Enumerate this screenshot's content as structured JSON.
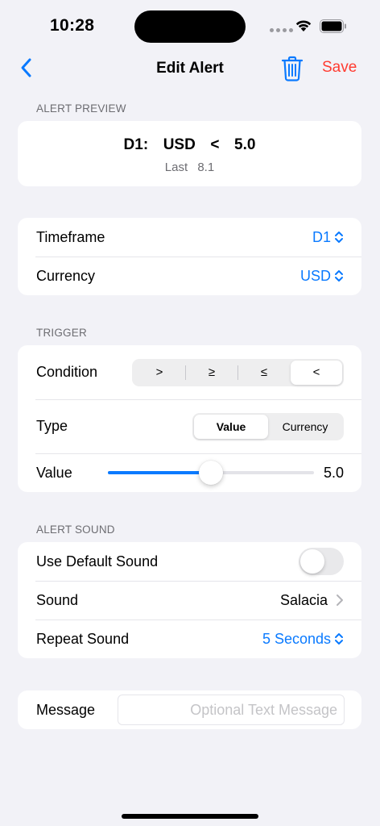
{
  "status_bar": {
    "time": "10:28"
  },
  "nav": {
    "title": "Edit Alert",
    "save_label": "Save",
    "back_icon": "chevron-left-icon",
    "delete_icon": "trash-icon"
  },
  "colors": {
    "accent": "#0A7AFF",
    "destructive": "#FF3B30",
    "background": "#F2F2F7"
  },
  "preview": {
    "header": "ALERT PREVIEW",
    "expression": "D1:  USD  <  5.0",
    "last_label": "Last",
    "last_value": "8.1"
  },
  "general": {
    "timeframe_label": "Timeframe",
    "timeframe_value": "D1",
    "currency_label": "Currency",
    "currency_value": "USD"
  },
  "trigger": {
    "header": "TRIGGER",
    "condition_label": "Condition",
    "conditions": [
      ">",
      "≥",
      "≤",
      "<"
    ],
    "condition_selected": "<",
    "type_label": "Type",
    "types": [
      "Value",
      "Currency"
    ],
    "type_selected": "Value",
    "value_label": "Value",
    "value_display": "5.0",
    "slider_fraction": 0.5
  },
  "sound": {
    "header": "ALERT SOUND",
    "default_label": "Use Default Sound",
    "default_on": false,
    "sound_label": "Sound",
    "sound_value": "Salacia",
    "repeat_label": "Repeat Sound",
    "repeat_value": "5 Seconds"
  },
  "message": {
    "label": "Message",
    "placeholder": "Optional Text Message",
    "value": ""
  }
}
